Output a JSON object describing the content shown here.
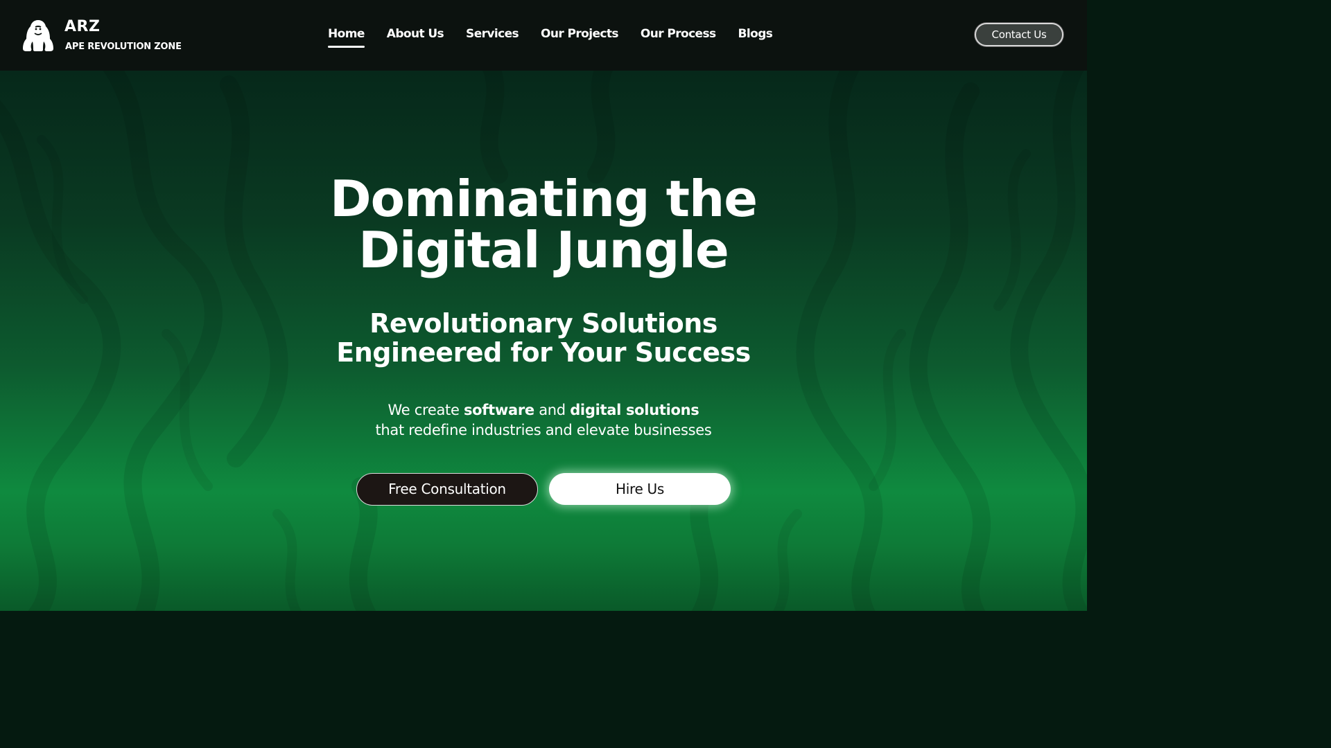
{
  "brand": {
    "logo_icon": "gorilla-logo-icon",
    "name": "ARZ",
    "tagline": "APE REVOLUTION ZONE"
  },
  "nav": {
    "items": [
      {
        "label": "Home",
        "active": true
      },
      {
        "label": "About Us",
        "active": false
      },
      {
        "label": "Services",
        "active": false
      },
      {
        "label": "Our Projects",
        "active": false
      },
      {
        "label": "Our Process",
        "active": false
      },
      {
        "label": "Blogs",
        "active": false
      }
    ],
    "contact_label": "Contact Us"
  },
  "hero": {
    "title_line1": "Dominating the",
    "title_line2": "Digital Jungle",
    "subtitle_line1": "Revolutionary Solutions",
    "subtitle_line2": "Engineered for Your Success",
    "desc_part1": "We create ",
    "desc_bold1": "software",
    "desc_part2": " and ",
    "desc_bold2": "digital solutions",
    "desc_line2": "that redefine industries and elevate businesses",
    "btn_consult": "Free Consultation",
    "btn_hire": "Hire Us"
  },
  "colors": {
    "header_bg": "#0c120f",
    "hero_green": "#0f8a3f",
    "hero_dark": "#06281a",
    "text": "#ffffff",
    "consult_bg": "#1c1614"
  }
}
